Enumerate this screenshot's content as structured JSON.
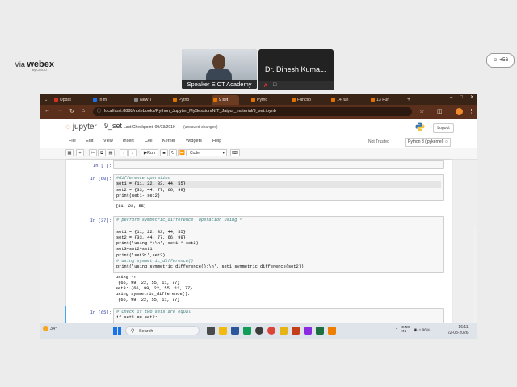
{
  "webex": {
    "via_label": "Via",
    "brand": "webex",
    "by": "by CISCO",
    "speaker_label": "Speaker EICT Academy",
    "participant_name": "Dr. Dinesh Kuma...",
    "participant_count": "+56"
  },
  "browser": {
    "tabs": [
      {
        "label": "Updat",
        "color": "#d93025"
      },
      {
        "label": "In m",
        "color": "#1a73e8"
      },
      {
        "label": "New T",
        "color": "#777777"
      },
      {
        "label": "Pytho",
        "color": "#e37400"
      },
      {
        "label": "9 set",
        "color": "#e37400"
      },
      {
        "label": "Pytho",
        "color": "#e37400"
      },
      {
        "label": "Functio",
        "color": "#e37400"
      },
      {
        "label": "14 fun",
        "color": "#e37400"
      },
      {
        "label": "13 Fun",
        "color": "#e37400"
      }
    ],
    "new_tab": "+",
    "url": "localhost:8888/notebooks/Python_Jupyter_MySession/NIT_Jaipur_material/9_set.ipynb"
  },
  "jupyter": {
    "logo": "jupyter",
    "notebook_name": "9_set",
    "checkpoint": "Last Checkpoint: 09/13/2019",
    "unsaved": "(unsaved changes)",
    "logout": "Logout",
    "menu": [
      "File",
      "Edit",
      "View",
      "Insert",
      "Cell",
      "Kernel",
      "Widgets",
      "Help"
    ],
    "trusted": "Not Trusted",
    "kernel": "Python 3 (ipykernel)",
    "run_label": "Run",
    "cell_type": "Code"
  },
  "cells": {
    "c0": {
      "prompt": "In [ ]:"
    },
    "c1": {
      "prompt": "In [60]:",
      "code": [
        "#difference operation",
        "set1 = {11, 22, 33, 44, 55}",
        "set2 = {33, 44, 77, 66, 99}",
        "print(set1- set2)"
      ],
      "output": [
        "{11, 22, 55}"
      ]
    },
    "c2": {
      "prompt": "In [37]:",
      "code": [
        "# perform symmetric_difference  operation using ^",
        "",
        "set1 = {11, 22, 33, 44, 55}",
        "set2 = {33, 44, 77, 66, 99}",
        "print('using ^:\\n', set1 ^ set2)",
        "set3=set2^set1",
        "print('set3:',set3)",
        "# using symmetric_difference()",
        "print('using symmetric_difference():\\n', set1.symmetric_difference(set2))"
      ],
      "output": [
        "using ^:",
        " {66, 99, 22, 55, 11, 77}",
        "set3: {66, 99, 22, 55, 11, 77}",
        "using symmetric_difference():",
        " {66, 99, 22, 55, 11, 77}"
      ]
    },
    "c3": {
      "prompt": "In [65]:",
      "code": [
        "# Check if two sets are equal",
        "if set1 == set2:"
      ]
    }
  },
  "taskbar": {
    "weather": "34°",
    "search": "Search",
    "lang": "ENG",
    "lang2": "IN",
    "battery": "96%",
    "time": "16:11",
    "date": "22-08-2026"
  }
}
